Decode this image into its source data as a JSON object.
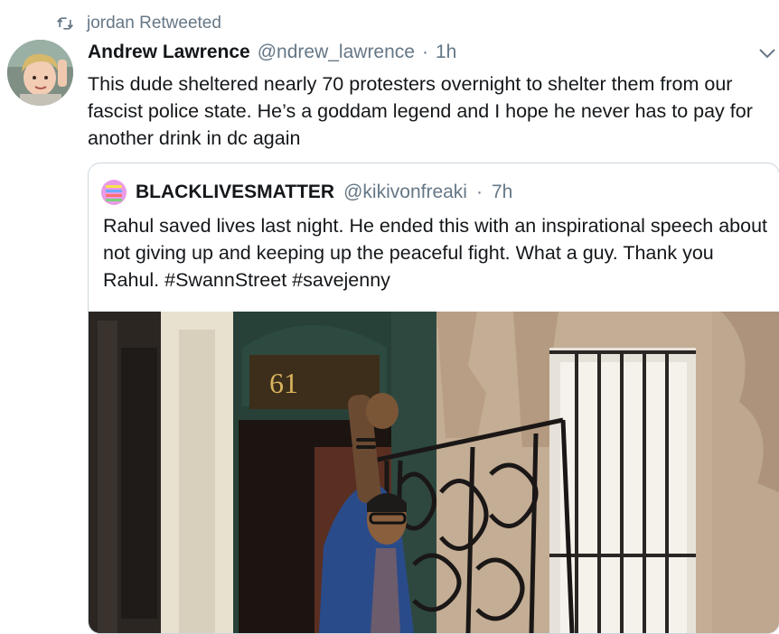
{
  "retweet": {
    "icon": "retweet-icon",
    "label": "jordan Retweeted"
  },
  "tweet": {
    "avatar_icon": "user-avatar",
    "display_name": "Andrew Lawrence",
    "handle": "@ndrew_lawrence",
    "separator": "·",
    "time": "1h",
    "caret_icon": "chevron-down-icon",
    "text": "This dude sheltered nearly 70 protesters overnight to shelter them from our fascist police state. He’s a goddam legend and I hope he never has to pay for another drink in dc again"
  },
  "quoted_tweet": {
    "avatar_icon": "blm-avatar",
    "display_name": "BLACKLIVESMATTER",
    "handle": "@kikivonfreaki",
    "separator": "·",
    "time": "7h",
    "text": "Rahul saved lives last night. He ended this with an inspirational speech about not giving up and keeping up the peaceful fight. What a guy. Thank you Rahul. #SwannStreet #savejenny",
    "media": {
      "icon": "photo-man-fist-raised",
      "door_number": "61"
    }
  },
  "colors": {
    "text": "#14171a",
    "secondary": "#657786",
    "border": "#ccd6dd",
    "background": "#ffffff"
  }
}
